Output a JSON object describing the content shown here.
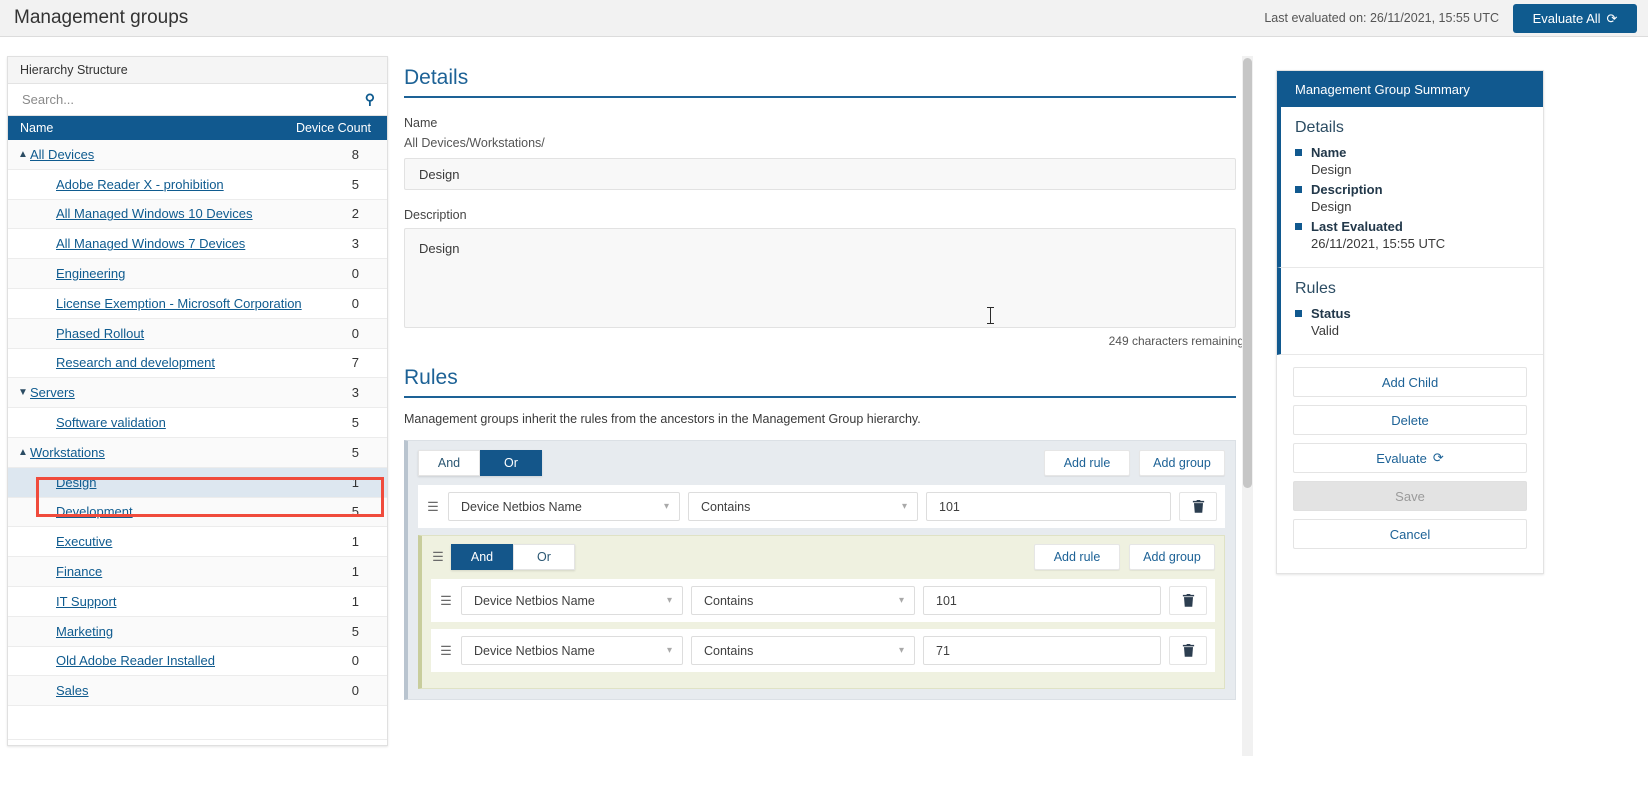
{
  "header": {
    "title": "Management groups",
    "last_evaluated_label": "Last evaluated on: 26/11/2021, 15:55 UTC",
    "evaluate_all_label": "Evaluate All",
    "refresh_icon": "refresh-icon"
  },
  "sidebar": {
    "panel_title": "Hierarchy Structure",
    "search_placeholder": "Search...",
    "search_value": "",
    "search_icon": "search-icon",
    "columns": {
      "name": "Name",
      "device_count": "Device Count"
    },
    "rows": [
      {
        "label": "All Devices",
        "count": "8",
        "indent": 0,
        "caret": "up",
        "selected": false
      },
      {
        "label": "Adobe Reader X - prohibition",
        "count": "5",
        "indent": 1,
        "caret": "none",
        "selected": false
      },
      {
        "label": "All Managed Windows 10 Devices",
        "count": "2",
        "indent": 1,
        "caret": "none",
        "selected": false
      },
      {
        "label": "All Managed Windows 7 Devices",
        "count": "3",
        "indent": 1,
        "caret": "none",
        "selected": false
      },
      {
        "label": "Engineering",
        "count": "0",
        "indent": 1,
        "caret": "none",
        "selected": false
      },
      {
        "label": "License Exemption - Microsoft Corporation",
        "count": "0",
        "indent": 1,
        "caret": "none",
        "selected": false
      },
      {
        "label": "Phased Rollout",
        "count": "0",
        "indent": 1,
        "caret": "none",
        "selected": false
      },
      {
        "label": "Research and development",
        "count": "7",
        "indent": 1,
        "caret": "none",
        "selected": false
      },
      {
        "label": "Servers",
        "count": "3",
        "indent": 0,
        "caret": "down",
        "selected": false
      },
      {
        "label": "Software validation",
        "count": "5",
        "indent": 1,
        "caret": "none",
        "selected": false
      },
      {
        "label": "Workstations",
        "count": "5",
        "indent": 0,
        "caret": "up",
        "selected": false
      },
      {
        "label": "Design",
        "count": "1",
        "indent": 1,
        "caret": "none",
        "selected": true
      },
      {
        "label": "Development",
        "count": "5",
        "indent": 1,
        "caret": "none",
        "selected": false
      },
      {
        "label": "Executive",
        "count": "1",
        "indent": 1,
        "caret": "none",
        "selected": false
      },
      {
        "label": "Finance",
        "count": "1",
        "indent": 1,
        "caret": "none",
        "selected": false
      },
      {
        "label": "IT Support",
        "count": "1",
        "indent": 1,
        "caret": "none",
        "selected": false
      },
      {
        "label": "Marketing",
        "count": "5",
        "indent": 1,
        "caret": "none",
        "selected": false
      },
      {
        "label": "Old Adobe Reader Installed",
        "count": "0",
        "indent": 1,
        "caret": "none",
        "selected": false
      },
      {
        "label": "Sales",
        "count": "0",
        "indent": 1,
        "caret": "none",
        "selected": false
      }
    ]
  },
  "details": {
    "section_title": "Details",
    "name_label": "Name",
    "name_path": "All Devices/Workstations/",
    "name_value": "Design",
    "description_label": "Description",
    "description_value": "Design",
    "chars_remaining": "249 characters remaining"
  },
  "rules": {
    "section_title": "Rules",
    "note": "Management groups inherit the rules from the ancestors in the Management Group hierarchy.",
    "outer_group": {
      "and_label": "And",
      "or_label": "Or",
      "active": "Or",
      "add_rule_label": "Add rule",
      "add_group_label": "Add group",
      "rules": [
        {
          "field": "Device Netbios Name",
          "operator": "Contains",
          "value": "101",
          "delete_icon": "trash-icon"
        }
      ]
    },
    "inner_group": {
      "and_label": "And",
      "or_label": "Or",
      "active": "And",
      "add_rule_label": "Add rule",
      "add_group_label": "Add group",
      "rules": [
        {
          "field": "Device Netbios Name",
          "operator": "Contains",
          "value": "101",
          "delete_icon": "trash-icon"
        },
        {
          "field": "Device Netbios Name",
          "operator": "Contains",
          "value": "71",
          "delete_icon": "trash-icon"
        }
      ]
    }
  },
  "summary": {
    "panel_title": "Management Group Summary",
    "details_heading": "Details",
    "details_items": [
      {
        "key": "Name",
        "value": "Design"
      },
      {
        "key": "Description",
        "value": "Design"
      },
      {
        "key": "Last Evaluated",
        "value": "26/11/2021, 15:55 UTC"
      }
    ],
    "rules_heading": "Rules",
    "rules_items": [
      {
        "key": "Status",
        "value": "Valid"
      }
    ],
    "actions": [
      {
        "label": "Add Child",
        "disabled": false,
        "icon": ""
      },
      {
        "label": "Delete",
        "disabled": false,
        "icon": ""
      },
      {
        "label": "Evaluate",
        "disabled": false,
        "icon": "refresh-icon"
      },
      {
        "label": "Save",
        "disabled": true,
        "icon": ""
      },
      {
        "label": "Cancel",
        "disabled": false,
        "icon": ""
      }
    ]
  },
  "colors": {
    "brand_blue": "#11598f",
    "link_blue": "#0f5b8f",
    "highlight_red": "#f04b3c",
    "inner_group_bg": "#eff1e0",
    "outer_group_bg": "#e7ebef"
  }
}
